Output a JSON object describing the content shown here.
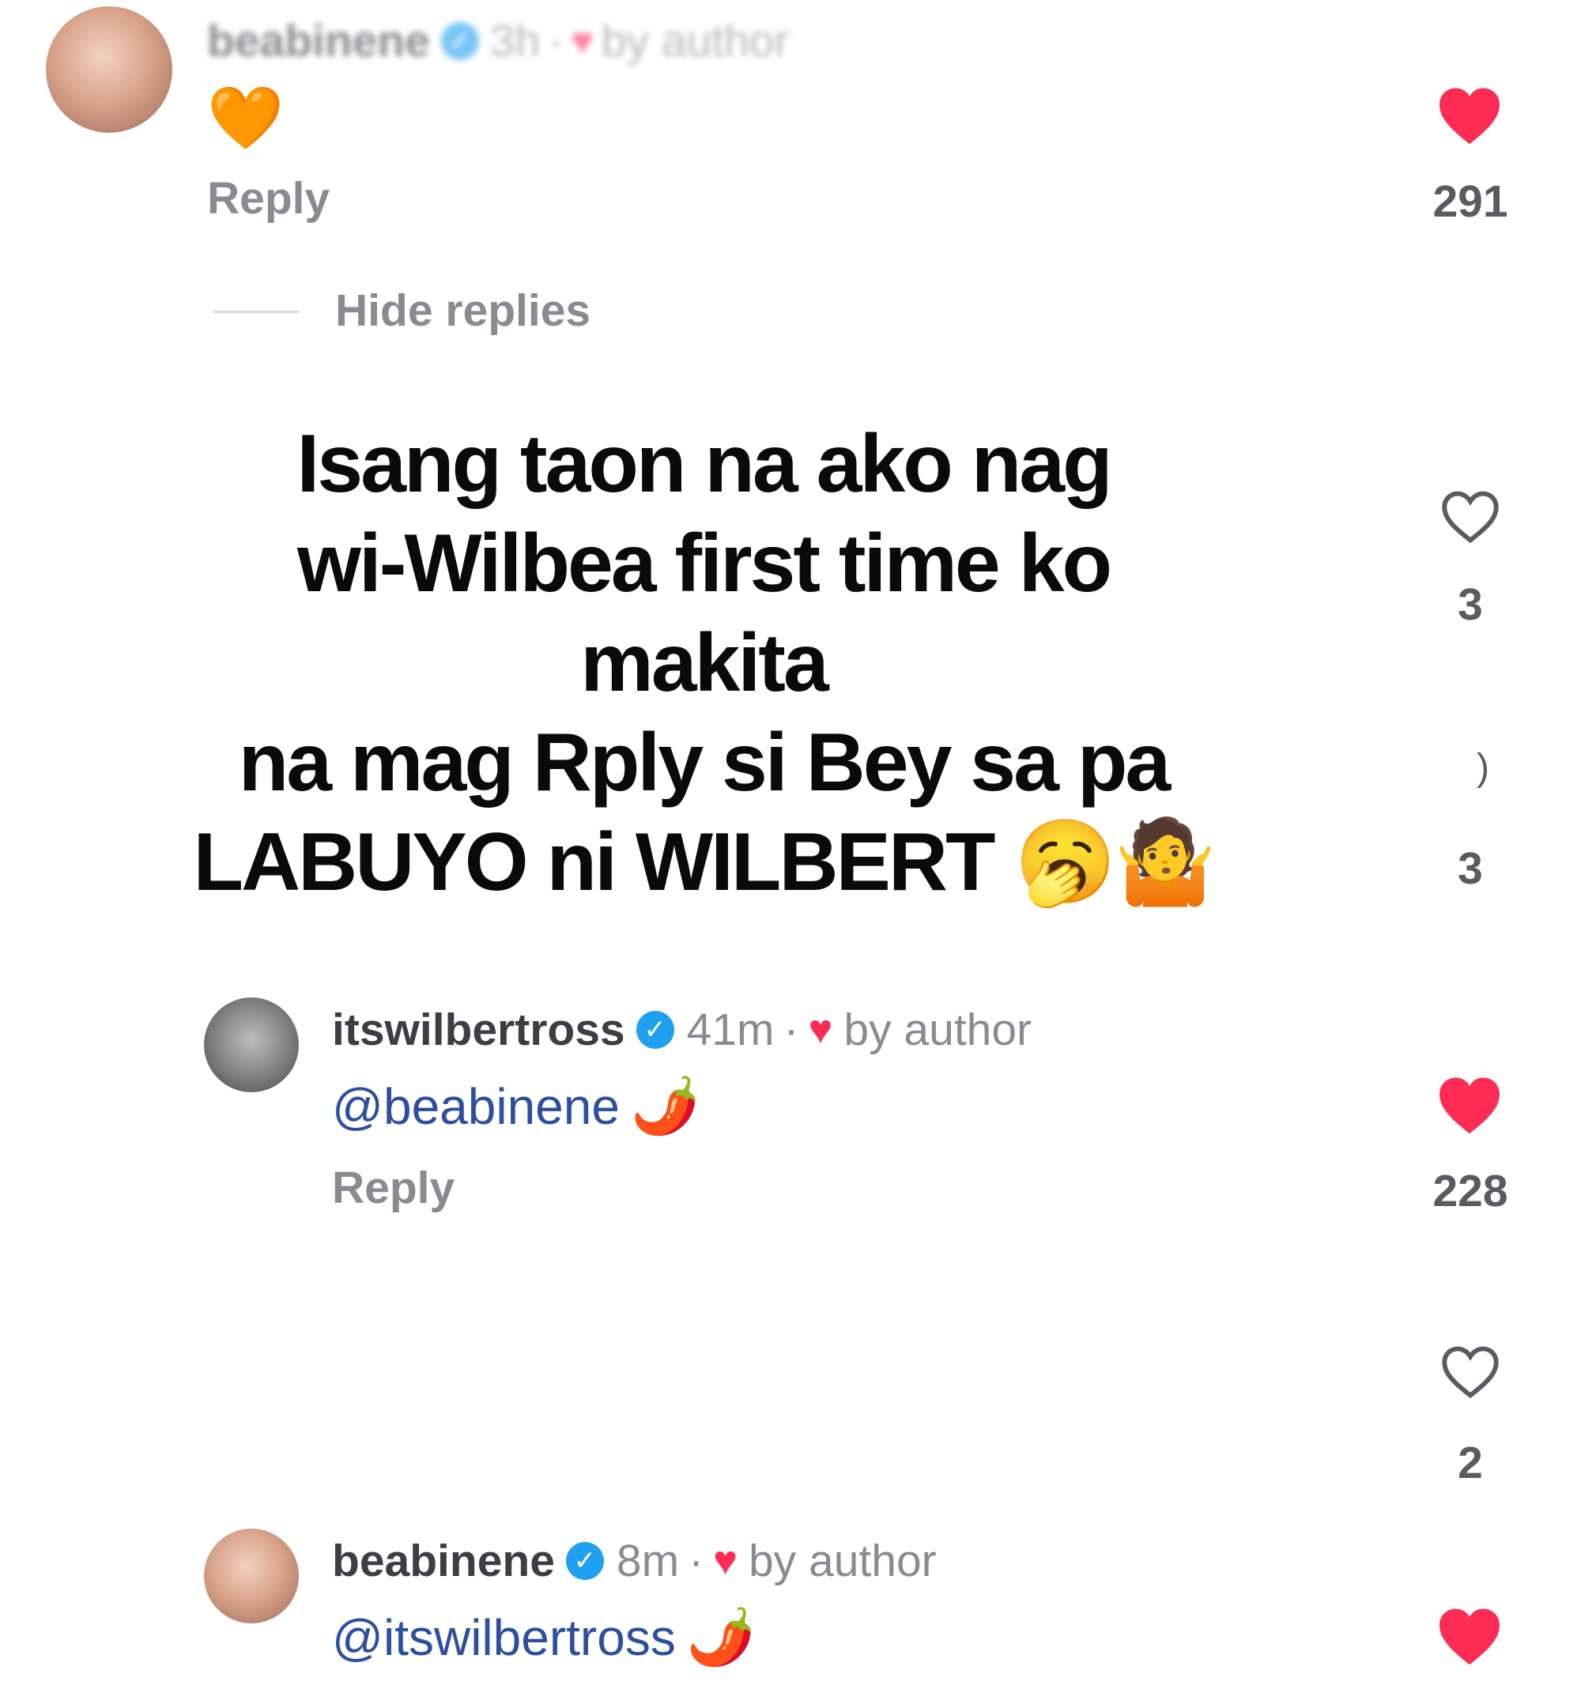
{
  "colors": {
    "liked_heart": "#fe2c55",
    "mention": "#2d4fa0",
    "verified": "#20a0f0",
    "muted": "#8a8b91"
  },
  "top_comment": {
    "username": "beabinene",
    "time": "3h",
    "author_liked_label": "by author",
    "emoji": "🧡",
    "reply_label": "Reply",
    "like_count": "291",
    "liked": true
  },
  "hide_replies_label": "Hide replies",
  "overlay": {
    "lines": [
      "Isang taon na ako nag",
      "wi-Wilbea first time ko makita",
      "na mag Rply si Bey sa pa",
      "LABUYO ni WILBERT 🥱🤷"
    ]
  },
  "side_counts": {
    "first_heart_count": "3",
    "second_count": "3",
    "third_heart_count": "2"
  },
  "reply_1": {
    "username": "itswilbertross",
    "time": "41m",
    "author_liked_label": "by author",
    "mention": "@beabinene",
    "emoji": "🌶️",
    "reply_label": "Reply",
    "like_count": "228",
    "liked": true
  },
  "reply_2": {
    "username": "beabinene",
    "time": "8m",
    "author_liked_label": "by author",
    "mention": "@itswilbertross",
    "emoji": "🌶️",
    "liked": true
  }
}
